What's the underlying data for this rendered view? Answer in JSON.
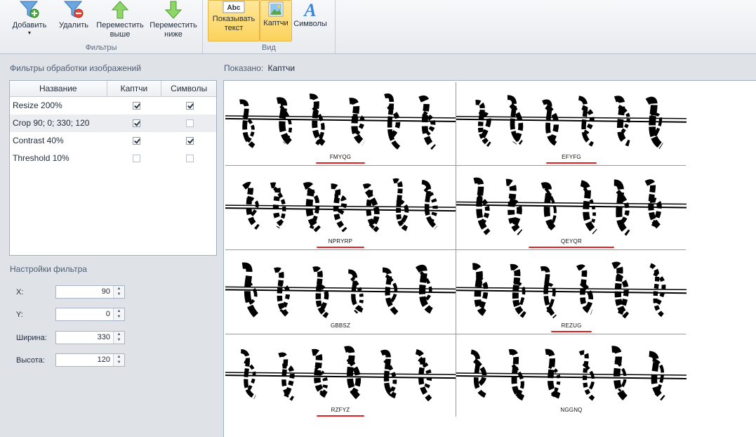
{
  "ribbon": {
    "filters_group": {
      "label": "Фильтры",
      "add_label": "Добавить",
      "remove_label": "Удалить",
      "move_up_label": "Переместить выше",
      "move_down_label": "Переместить ниже"
    },
    "view_group": {
      "label": "Вид",
      "show_text_label": "Показывать текст",
      "captcha_label": "Каптчи",
      "symbols_label": "Символы"
    }
  },
  "filters_panel": {
    "title": "Фильтры обработки изображений",
    "columns": [
      "Название",
      "Каптчи",
      "Символы"
    ],
    "rows": [
      {
        "name": "Resize 200%",
        "captcha": true,
        "symbols": true
      },
      {
        "name": "Crop 90; 0; 330; 120",
        "captcha": true,
        "symbols": false
      },
      {
        "name": "Contrast 40%",
        "captcha": true,
        "symbols": true
      },
      {
        "name": "Threshold 10%",
        "captcha": false,
        "symbols": false
      }
    ]
  },
  "settings_panel": {
    "title": "Настройки фильтра",
    "fields": [
      {
        "label": "X:",
        "value": "90"
      },
      {
        "label": "Y:",
        "value": "0"
      },
      {
        "label": "Ширина:",
        "value": "330"
      },
      {
        "label": "Высота:",
        "value": "120"
      }
    ]
  },
  "shown": {
    "label": "Показано:",
    "value": "Каптчи"
  },
  "captchas": [
    {
      "text": "FMYQG",
      "underlined": true
    },
    {
      "text": "EFYFG",
      "underlined": true
    },
    {
      "text": "NPRYRP",
      "underlined": true
    },
    {
      "text": "QEYQR",
      "underlined": true
    },
    {
      "text": "GBBSZ",
      "underlined": false
    },
    {
      "text": "REZUG",
      "underlined": true
    },
    {
      "text": "RZFYZ",
      "underlined": true
    },
    {
      "text": "NGGNQ",
      "underlined": false
    }
  ],
  "colors": {
    "active_button": "#fcd25c",
    "annotation_red": "#e02020"
  }
}
